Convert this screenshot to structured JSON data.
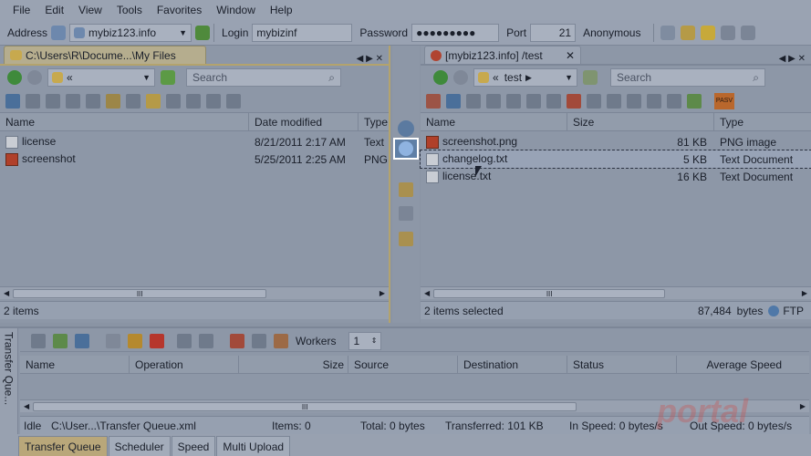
{
  "menu": [
    "File",
    "Edit",
    "View",
    "Tools",
    "Favorites",
    "Window",
    "Help"
  ],
  "connection": {
    "address_label": "Address",
    "address_value": "mybiz123.info",
    "login_label": "Login",
    "login_value": "mybizinf",
    "password_label": "Password",
    "password_value": "●●●●●●●●●",
    "port_label": "Port",
    "port_value": "21",
    "anonymous_label": "Anonymous"
  },
  "left": {
    "tab_title": "C:\\Users\\R\\Docume...\\My Files",
    "path": "«",
    "search_placeholder": "Search",
    "columns": [
      "Name",
      "Date modified",
      "Type"
    ],
    "rows": [
      {
        "name": "license",
        "date": "8/21/2011 2:17 AM",
        "type": "Text",
        "icon": "txt"
      },
      {
        "name": "screenshot",
        "date": "5/25/2011 2:25 AM",
        "type": "PNG",
        "icon": "png"
      }
    ],
    "scroll_grip": "III",
    "status": "2 items"
  },
  "right": {
    "tab_title": "[mybiz123.info] /test",
    "path_prefix": "«",
    "path": "test",
    "search_placeholder": "Search",
    "columns": [
      "Name",
      "Size",
      "Type"
    ],
    "rows": [
      {
        "name": "screenshot.png",
        "size": "81 KB",
        "type": "PNG image",
        "icon": "png"
      },
      {
        "name": "changelog.txt",
        "size": "5 KB",
        "type": "Text Document",
        "icon": "txt"
      },
      {
        "name": "license.txt",
        "size": "16 KB",
        "type": "Text Document",
        "icon": "txt"
      }
    ],
    "pasv": "PASV",
    "scroll_grip": "III",
    "status": "2 items selected",
    "bytes": "87,484",
    "bytes_unit": "bytes",
    "protocol": "FTP"
  },
  "queue": {
    "side_label": "Transfer Que...",
    "workers_label": "Workers",
    "workers_value": "1",
    "columns": [
      "Name",
      "Operation",
      "Size",
      "Source",
      "Destination",
      "Status",
      "Average Speed"
    ],
    "scroll_grip": "III",
    "status": {
      "idle": "Idle",
      "file": "C:\\User...\\Transfer Queue.xml",
      "items": "Items: 0",
      "total": "Total: 0 bytes",
      "transferred": "Transferred: 101 KB",
      "in_speed": "In Speed: 0 bytes/s",
      "out_speed": "Out Speed: 0 bytes/s"
    }
  },
  "bottom_tabs": [
    "Transfer Queue",
    "Scheduler",
    "Speed",
    "Multi Upload"
  ],
  "watermark": "portal"
}
